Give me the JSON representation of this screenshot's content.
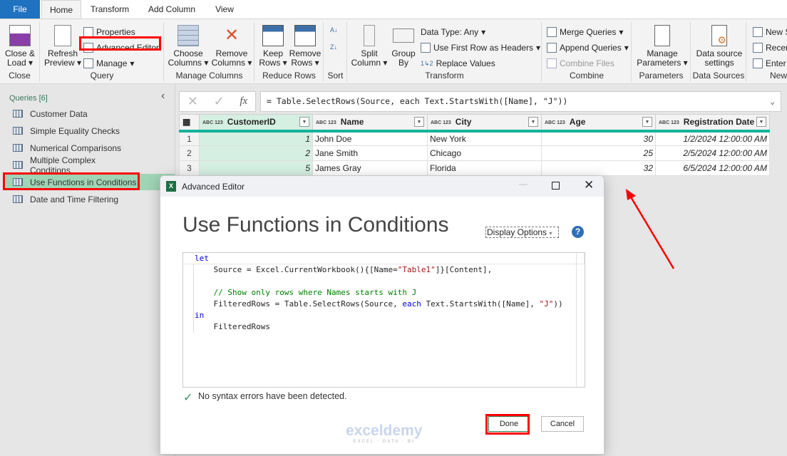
{
  "tabs": [
    "File",
    "Home",
    "Transform",
    "Add Column",
    "View"
  ],
  "ribbon": {
    "close": {
      "btn": "Close &",
      "btn2": "Load",
      "label": "Close"
    },
    "query": {
      "refresh": "Refresh",
      "refresh2": "Preview",
      "properties": "Properties",
      "advanced_editor": "Advanced Editor",
      "manage": "Manage",
      "label": "Query"
    },
    "manage_columns": {
      "choose": "Choose",
      "choose2": "Columns",
      "remove": "Remove",
      "remove2": "Columns",
      "label": "Manage Columns"
    },
    "reduce_rows": {
      "keep": "Keep",
      "keep2": "Rows",
      "remove": "Remove",
      "remove2": "Rows",
      "label": "Reduce Rows"
    },
    "sort": {
      "label": "Sort"
    },
    "transform": {
      "split": "Split",
      "split2": "Column",
      "group": "Group",
      "group2": "By",
      "data_type": "Data Type: Any",
      "first_row": "Use First Row as Headers",
      "replace": "Replace Values",
      "label": "Transform"
    },
    "combine": {
      "merge": "Merge Queries",
      "append": "Append Queries",
      "combine_files": "Combine Files",
      "label": "Combine"
    },
    "parameters": {
      "manage": "Manage",
      "manage2": "Parameters",
      "label": "Parameters"
    },
    "data_sources": {
      "settings": "Data source",
      "settings2": "settings",
      "label": "Data Sources"
    },
    "new_query": {
      "new_source": "New S",
      "recent": "Recen",
      "enter": "Enter",
      "label": "New"
    }
  },
  "queries": {
    "header": "Queries [6]",
    "items": [
      "Customer Data",
      "Simple Equality Checks",
      "Numerical Comparisons",
      "Multiple Complex Conditions",
      "Use Functions in Conditions",
      "Date and Time Filtering"
    ],
    "selected_index": 4
  },
  "formula": "= Table.SelectRows(Source, each Text.StartsWith([Name], \"J\"))",
  "formula_icons": {
    "cancel": "✕",
    "confirm": "✓",
    "fx": "fx"
  },
  "table": {
    "type_badge": "ABC 123",
    "columns": [
      "CustomerID",
      "Name",
      "City",
      "Age",
      "Registration Date"
    ],
    "rows": [
      [
        "1",
        "1",
        "John Doe",
        "New York",
        "30",
        "1/2/2024 12:00:00 AM"
      ],
      [
        "2",
        "2",
        "Jane Smith",
        "Chicago",
        "25",
        "2/5/2024 12:00:00 AM"
      ],
      [
        "3",
        "5",
        "James Gray",
        "Florida",
        "32",
        "6/5/2024 12:00:00 AM"
      ]
    ]
  },
  "dialog": {
    "title": "Advanced Editor",
    "heading": "Use Functions in Conditions",
    "display_options": "Display Options",
    "help": "?",
    "code": [
      [
        {
          "t": "let",
          "c": "kw"
        }
      ],
      [
        {
          "t": "    Source = Excel.CurrentWorkbook(){[Name=",
          "c": ""
        },
        {
          "t": "\"Table1\"",
          "c": "st"
        },
        {
          "t": "]}[Content],",
          "c": ""
        }
      ],
      [],
      [
        {
          "t": "    // Show only rows where Names starts with J",
          "c": "cm"
        }
      ],
      [
        {
          "t": "    FilteredRows = Table.SelectRows(Source, ",
          "c": ""
        },
        {
          "t": "each",
          "c": "kw"
        },
        {
          "t": " Text.StartsWith([Name], ",
          "c": ""
        },
        {
          "t": "\"J\"",
          "c": "st"
        },
        {
          "t": "))",
          "c": ""
        }
      ],
      [
        {
          "t": "in",
          "c": "kw"
        }
      ],
      [
        {
          "t": "    FilteredRows",
          "c": ""
        }
      ]
    ],
    "status": "No syntax errors have been detected.",
    "done": "Done",
    "cancel": "Cancel"
  },
  "watermark": {
    "name": "exceldemy",
    "tag": "EXCEL · DATA · BI"
  },
  "colors": {
    "accent": "#15b39a",
    "file": "#1f72c0",
    "highlight": "#ff0000",
    "selected": "#9fd4b5"
  }
}
